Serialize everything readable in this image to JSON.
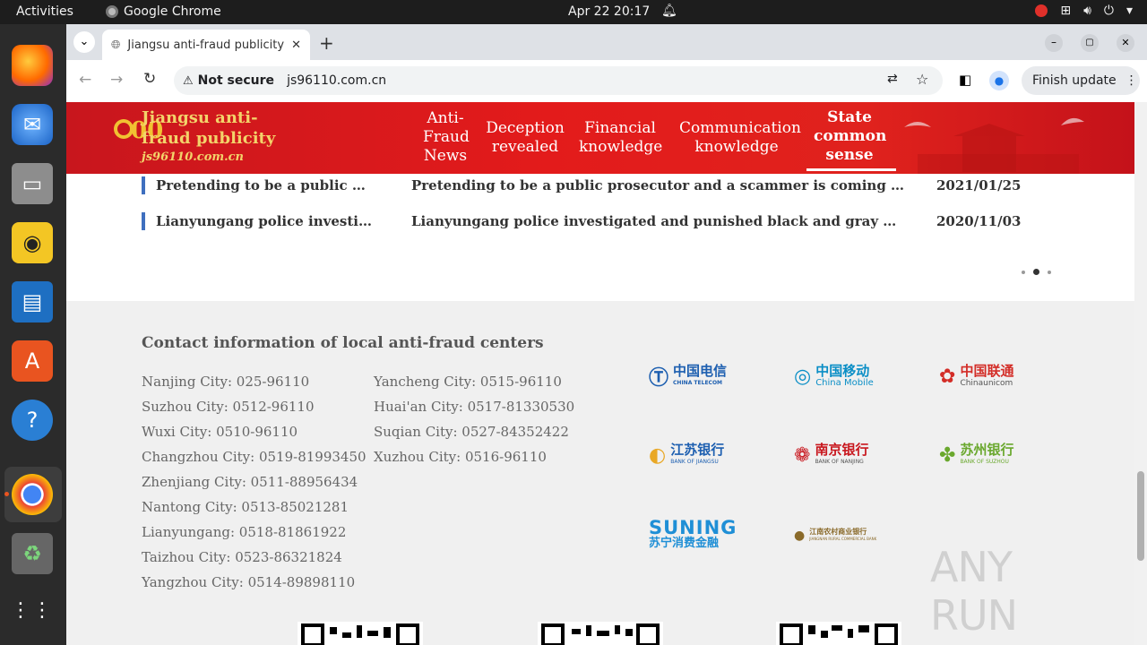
{
  "os": {
    "activities": "Activities",
    "app_name": "Google Chrome",
    "clock": "Apr 22  20:17"
  },
  "browser": {
    "tab_title": "Jiangsu anti-fraud publicity",
    "security": "Not secure",
    "url": "js96110.com.cn",
    "finish_update": "Finish update"
  },
  "site": {
    "name": "Jiangsu anti-fraud publicity",
    "domain": "js96110.com.cn",
    "nav": [
      {
        "label": "Anti-Fraud News"
      },
      {
        "label": "Deception revealed"
      },
      {
        "label": "Financial knowledge"
      },
      {
        "label": "Communication knowledge"
      },
      {
        "label": "State common sense",
        "selected": true
      }
    ],
    "news": [
      {
        "title": "Pretending to be a public …",
        "summary": "Pretending to be a public prosecutor and a scammer is coming …",
        "date": "2021/01/25"
      },
      {
        "title": "Lianyungang police investi…",
        "summary": "Lianyungang police investigated and punished black and gray …",
        "date": "2020/11/03"
      }
    ],
    "pager": {
      "total": 3,
      "current": 2
    }
  },
  "footer": {
    "title": "Contact information of local anti-fraud centers",
    "col1": [
      "Nanjing City: 025-96110",
      "Suzhou City: 0512-96110",
      "Wuxi City: 0510-96110",
      "Changzhou City: 0519-81993450",
      "Zhenjiang City: 0511-88956434",
      "Nantong City: 0513-85021281",
      "Lianyungang: 0518-81861922",
      "Taizhou City: 0523-86321824",
      "Yangzhou City: 0514-89898110"
    ],
    "col2": [
      "Yancheng City: 0515-96110",
      "Huai'an City: 0517-81330530",
      "Suqian City: 0527-84352422",
      "Xuzhou City: 0516-96110"
    ],
    "brands": [
      {
        "cn": "中国电信",
        "en": "CHINA TELECOM",
        "color": "#1d5fb0"
      },
      {
        "cn": "中国移动",
        "en": "China Mobile",
        "color": "#0a8ec6"
      },
      {
        "cn": "中国联通",
        "en": "Chinaunicom",
        "color": "#d32d27"
      },
      {
        "cn": "江苏银行",
        "en": "BANK OF JIANGSU",
        "color": "#1d5fb0"
      },
      {
        "cn": "南京银行",
        "en": "BANK OF NANJING",
        "color": "#c8161d"
      },
      {
        "cn": "苏州银行",
        "en": "BANK OF SUZHOU",
        "color": "#6aa82e"
      },
      {
        "cn": "SUNING",
        "en": "苏宁消费金融",
        "color": "#1f8fd6"
      },
      {
        "cn": "江南农村商业银行",
        "en": "JIANGNAN RURAL COMMERCIAL BANK",
        "color": "#8a6a2a"
      }
    ]
  },
  "watermark": "ANY RUN"
}
